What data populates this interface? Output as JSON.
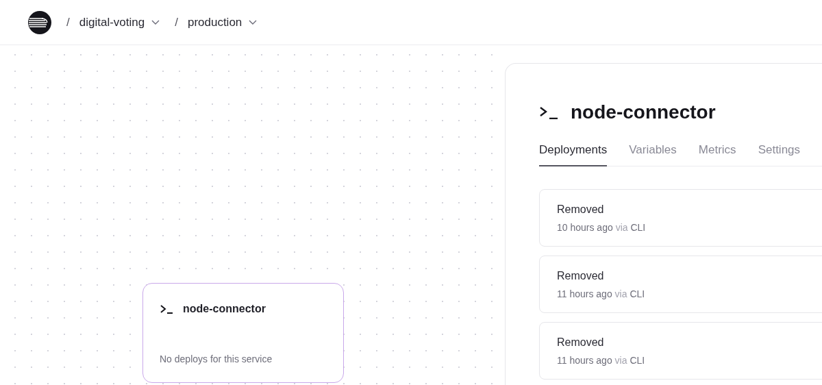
{
  "breadcrumb": [
    {
      "separator": "/",
      "label": "digital-voting",
      "dropdown": true
    },
    {
      "separator": "/",
      "label": "production",
      "dropdown": true
    }
  ],
  "canvas": {
    "node": {
      "title": "node-connector",
      "status": "No deploys for this service",
      "selected": true
    }
  },
  "panel": {
    "title": "node-connector",
    "tabs": [
      {
        "label": "Deployments",
        "selected": true
      },
      {
        "label": "Variables",
        "selected": false
      },
      {
        "label": "Metrics",
        "selected": false
      },
      {
        "label": "Settings",
        "selected": false
      }
    ],
    "deployments": [
      {
        "status": "Removed",
        "time": "10 hours ago",
        "via": "via",
        "source": "CLI"
      },
      {
        "status": "Removed",
        "time": "11 hours ago",
        "via": "via",
        "source": "CLI"
      },
      {
        "status": "Removed",
        "time": "11 hours ago",
        "via": "via",
        "source": "CLI"
      }
    ]
  }
}
